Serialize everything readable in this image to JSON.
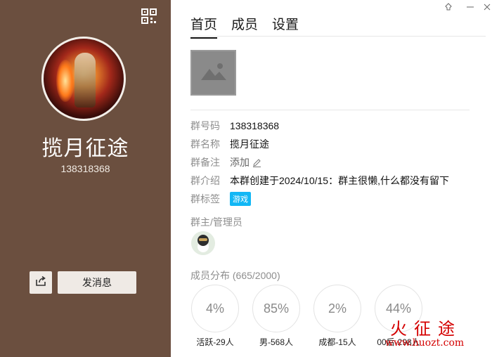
{
  "left_panel": {
    "group_name": "揽月征途",
    "group_id": "138318368",
    "send_message_label": "发消息"
  },
  "tabs": [
    {
      "label": "首页",
      "active": true
    },
    {
      "label": "成员",
      "active": false
    },
    {
      "label": "设置",
      "active": false
    }
  ],
  "info": {
    "number_key": "群号码",
    "number_value": "138318368",
    "name_key": "群名称",
    "name_value": "揽月征途",
    "remark_key": "群备注",
    "remark_value": "添加",
    "intro_key": "群介绍",
    "intro_value": "本群创建于2024/10/15：群主很懒,什么都没有留下",
    "tags_key": "群标签",
    "tag_value": "游戏"
  },
  "admins_label": "群主/管理员",
  "members_label": "成员分布 (665/2000)",
  "stats": [
    {
      "percent": "4%",
      "label": "活跃-29人"
    },
    {
      "percent": "85%",
      "label": "男-568人"
    },
    {
      "percent": "2%",
      "label": "成都-15人"
    },
    {
      "percent": "44%",
      "label": "00后-298人"
    }
  ],
  "watermark": {
    "text": "火征途",
    "url": "www.huozt.com"
  },
  "colors": {
    "left_panel_bg": "#6b4f3f",
    "tag_bg": "#12b7f5",
    "button_bg": "#efeae5"
  }
}
